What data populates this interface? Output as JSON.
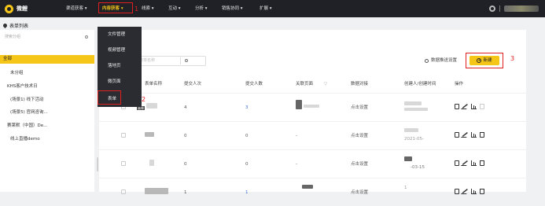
{
  "brand": {
    "name": "微鲤"
  },
  "nav": {
    "items": [
      {
        "label": "渠道获客 ▾"
      },
      {
        "label": "内容获客 ▾"
      },
      {
        "label": "线索 ▾"
      },
      {
        "label": "互动 ▾"
      },
      {
        "label": "分析 ▾"
      },
      {
        "label": "销售协同 ▾"
      },
      {
        "label": "扩展 ▾"
      }
    ]
  },
  "annotations": {
    "n1": "1",
    "n2": "2",
    "n3": "3"
  },
  "breadcrumb": {
    "label": "表单列表"
  },
  "sidebar": {
    "search_placeholder": "搜索分组",
    "items": [
      {
        "label": "全部"
      },
      {
        "label": "未分组"
      },
      {
        "label": "KHS客户技术日"
      },
      {
        "label": "(场景1) 线下活动"
      },
      {
        "label": "(场景5) 官网咨询..."
      },
      {
        "label": "赛莱默（中国）De..."
      },
      {
        "label": "线上直播demo"
      }
    ]
  },
  "dropdown": {
    "items": [
      {
        "label": "文件管理"
      },
      {
        "label": "视频管理"
      },
      {
        "label": "落地页"
      },
      {
        "label": "微页面"
      },
      {
        "label": "表单"
      }
    ]
  },
  "toolbar": {
    "search_placeholder": "表单名称",
    "settings_label": "数据推送设置",
    "new_label": "新建"
  },
  "table": {
    "columns": [
      "表单名称",
      "提交人次",
      "提交人数",
      "关联页面",
      "数据对接",
      "创建人/创建时间",
      "操作"
    ],
    "rows": [
      {
        "name": "",
        "submissions": "4",
        "submitters": "3",
        "page": "",
        "connect": "点击设置",
        "created": ""
      },
      {
        "name": "",
        "submissions": "0",
        "submitters": "0",
        "page": "-",
        "connect": "点击设置",
        "created": "2021-05-"
      },
      {
        "name": "",
        "submissions": "0",
        "submitters": "0",
        "page": "-",
        "connect": "点击设置",
        "created": "-03-15"
      },
      {
        "name": "",
        "submissions": "1",
        "submitters": "1",
        "page": "",
        "connect": "点击设置",
        "created": "1"
      }
    ]
  },
  "colors": {
    "accent": "#f5c518",
    "topbar": "#1f2126",
    "annotation": "#e02020",
    "link": "#3a6fd8"
  }
}
